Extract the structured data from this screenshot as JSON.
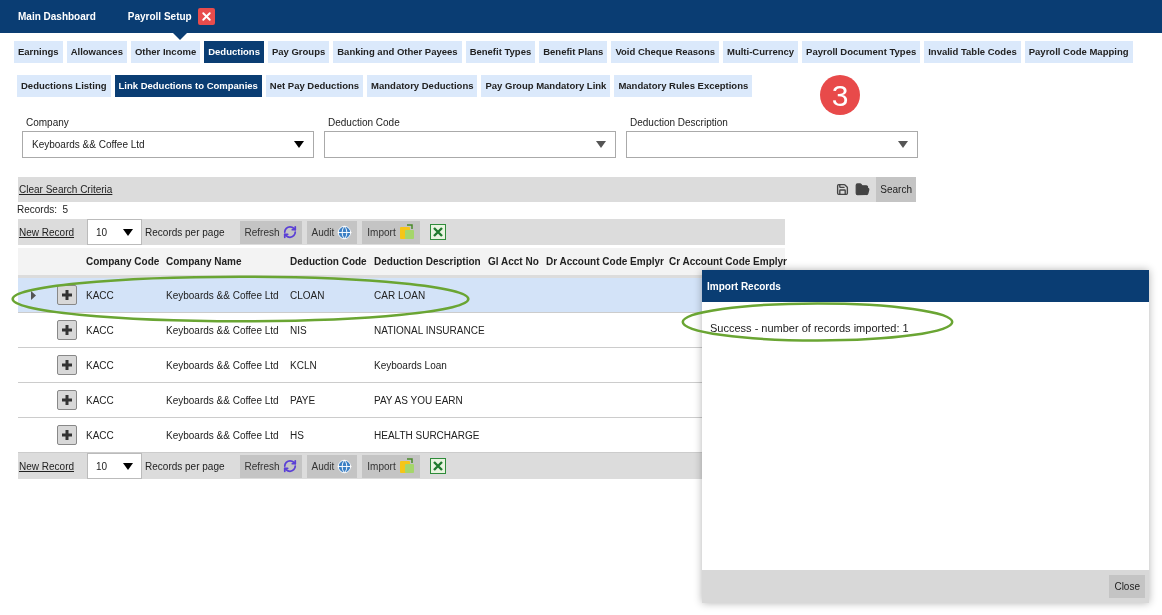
{
  "top_tabs": [
    {
      "label": "Main Dashboard",
      "selected": false,
      "closable": false
    },
    {
      "label": "Payroll Setup",
      "selected": true,
      "closable": true
    }
  ],
  "module_tabs": [
    {
      "label": "Earnings",
      "selected": false
    },
    {
      "label": "Allowances",
      "selected": false
    },
    {
      "label": "Other Income",
      "selected": false
    },
    {
      "label": "Deductions",
      "selected": true
    },
    {
      "label": "Pay Groups",
      "selected": false
    },
    {
      "label": "Banking and Other Payees",
      "selected": false
    },
    {
      "label": "Benefit Types",
      "selected": false
    },
    {
      "label": "Benefit Plans",
      "selected": false
    },
    {
      "label": "Void Cheque Reasons",
      "selected": false
    },
    {
      "label": "Multi-Currency",
      "selected": false
    },
    {
      "label": "Payroll Document Types",
      "selected": false
    },
    {
      "label": "Invalid Table Codes",
      "selected": false
    },
    {
      "label": "Payroll Code Mapping",
      "selected": false
    }
  ],
  "sub_tabs": [
    {
      "label": "Deductions Listing",
      "selected": false
    },
    {
      "label": "Link Deductions to Companies",
      "selected": true
    },
    {
      "label": "Net Pay Deductions",
      "selected": false
    },
    {
      "label": "Mandatory Deductions",
      "selected": false
    },
    {
      "label": "Pay Group Mandatory Link",
      "selected": false
    },
    {
      "label": "Mandatory Rules Exceptions",
      "selected": false
    }
  ],
  "step_badge": "3",
  "filters": [
    {
      "label": "Company",
      "value": "Keyboards && Coffee Ltd"
    },
    {
      "label": "Deduction Code"
    },
    {
      "label": "Deduction Description"
    }
  ],
  "search_bar": {
    "clear_link": "Clear Search Criteria",
    "search_button": "Search"
  },
  "records_label": "Records:  5",
  "pagers": [
    {
      "new_record": "New Record",
      "page_size": "10",
      "per_page_label": "Records per page",
      "buttons": [
        {
          "kind": "refresh",
          "label": "Refresh"
        },
        {
          "kind": "audit",
          "label": "Audit"
        },
        {
          "kind": "import",
          "label": "Import"
        },
        {
          "kind": "excel"
        }
      ]
    },
    {
      "new_record": "New Record",
      "page_size": "10",
      "per_page_label": "Records per page",
      "buttons": [
        {
          "kind": "refresh",
          "label": "Refresh"
        },
        {
          "kind": "audit",
          "label": "Audit"
        },
        {
          "kind": "import",
          "label": "Import"
        },
        {
          "kind": "excel"
        }
      ]
    }
  ],
  "table": {
    "columns": [
      "Company Code",
      "Company Name",
      "Deduction Code",
      "Deduction Description",
      "Gl Acct No",
      "Dr Account Code Emplyr",
      "Cr Account Code Emplyr"
    ],
    "rows": [
      {
        "selected": true,
        "cells": [
          "KACC",
          "Keyboards && Coffee Ltd",
          "CLOAN",
          "CAR LOAN"
        ]
      },
      {
        "selected": false,
        "cells": [
          "KACC",
          "Keyboards && Coffee Ltd",
          "NIS",
          "NATIONAL INSURANCE"
        ]
      },
      {
        "selected": false,
        "cells": [
          "KACC",
          "Keyboards && Coffee Ltd",
          "KCLN",
          "Keyboards Loan"
        ]
      },
      {
        "selected": false,
        "cells": [
          "KACC",
          "Keyboards && Coffee Ltd",
          "PAYE",
          "PAY AS YOU EARN"
        ]
      },
      {
        "selected": false,
        "cells": [
          "KACC",
          "Keyboards && Coffee Ltd",
          "HS",
          "HEALTH SURCHARGE"
        ]
      }
    ]
  },
  "dialog": {
    "title": "Import Records",
    "message": "Success - number of records imported: 1",
    "close_button": "Close"
  }
}
